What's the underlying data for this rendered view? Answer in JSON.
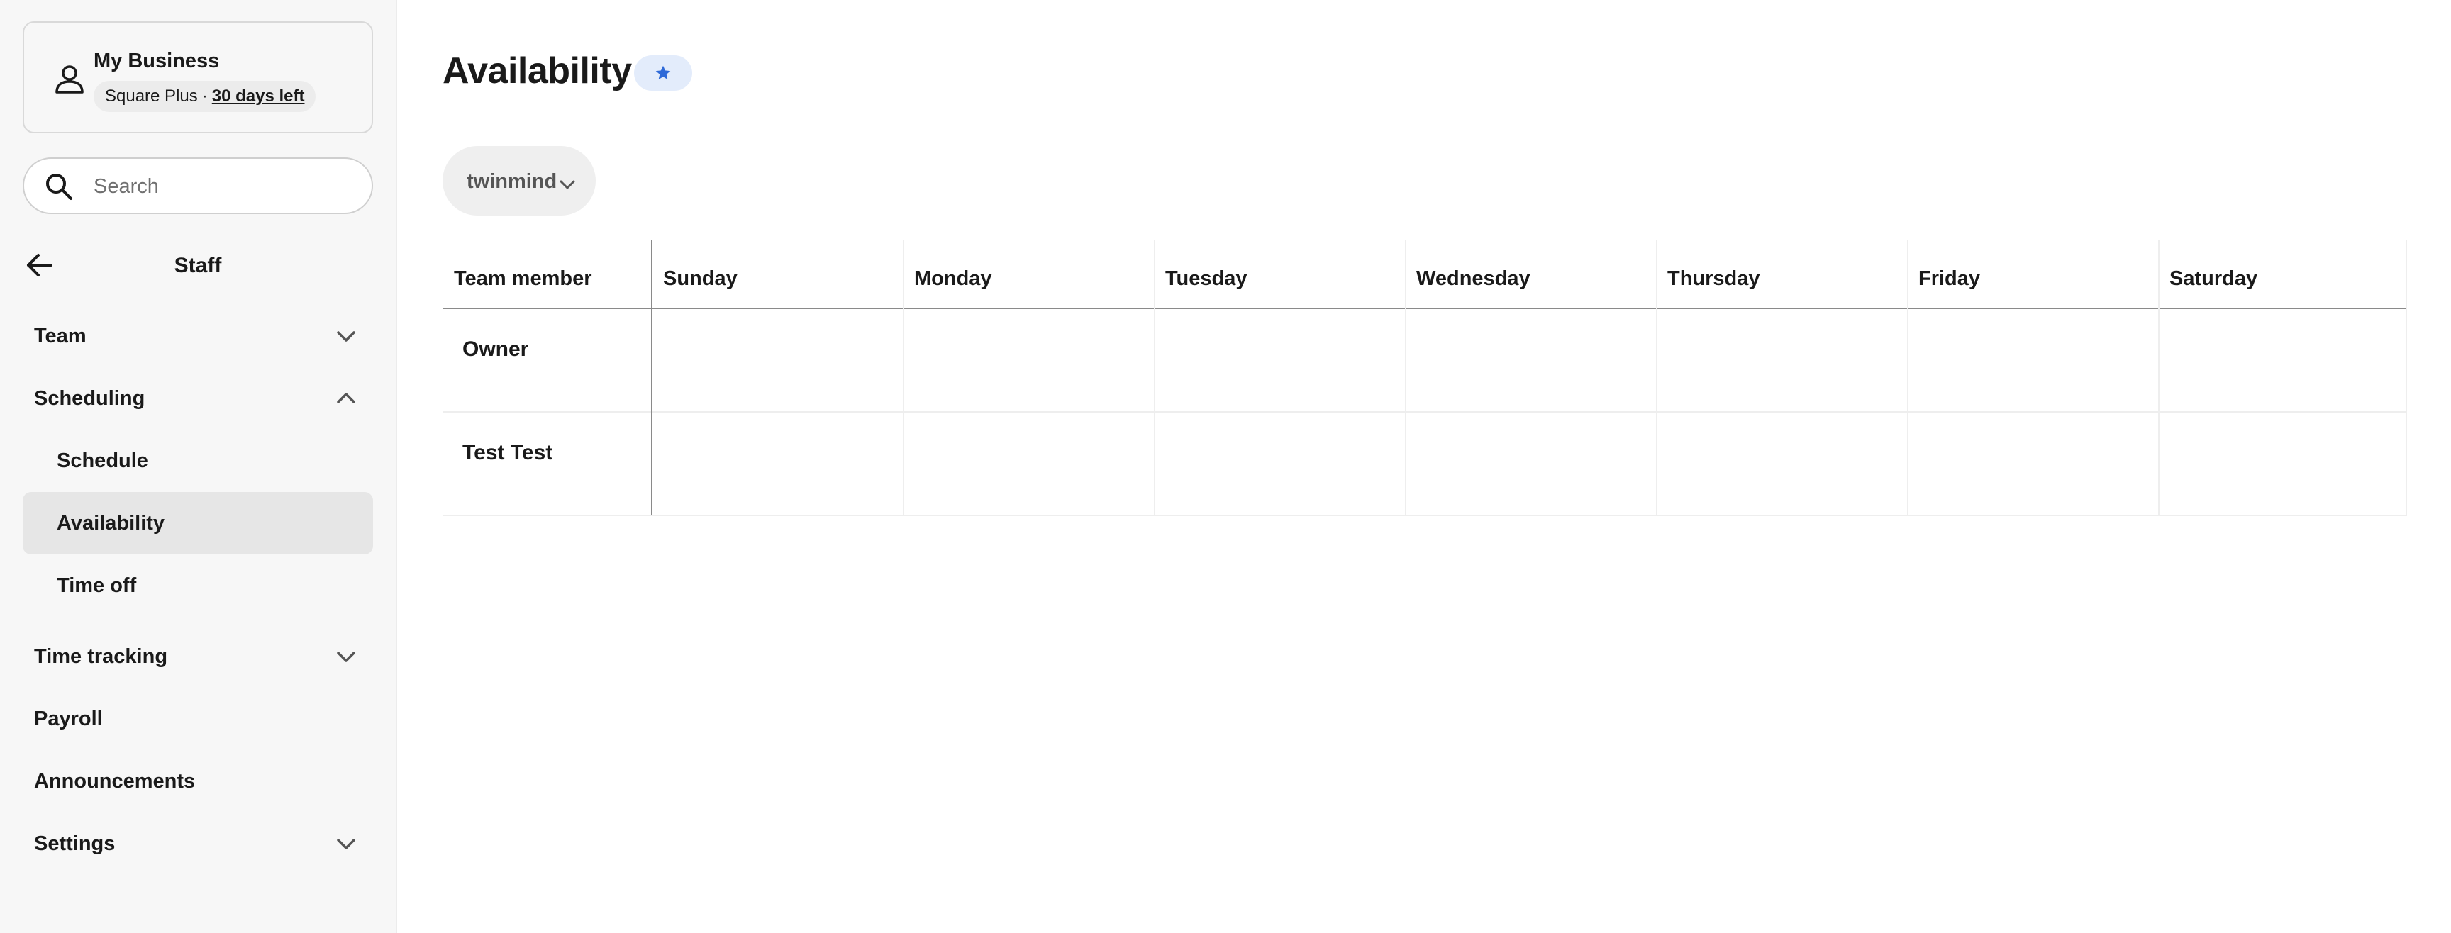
{
  "business": {
    "name": "My Business",
    "plan": "Square Plus",
    "separator": "·",
    "trial": "30 days left"
  },
  "search": {
    "placeholder": "Search"
  },
  "nav": {
    "section_title": "Staff",
    "items": [
      {
        "label": "Team",
        "expanded": false
      },
      {
        "label": "Scheduling",
        "expanded": true
      },
      {
        "label": "Schedule"
      },
      {
        "label": "Availability",
        "active": true
      },
      {
        "label": "Time off"
      },
      {
        "label": "Time tracking",
        "expanded": false
      },
      {
        "label": "Payroll"
      },
      {
        "label": "Announcements"
      },
      {
        "label": "Settings",
        "expanded": false
      }
    ]
  },
  "main": {
    "title": "Availability",
    "filter_label": "twinmind",
    "accent_color": "#2f6ad8"
  },
  "grid": {
    "columns": [
      "Team member",
      "Sunday",
      "Monday",
      "Tuesday",
      "Wednesday",
      "Thursday",
      "Friday",
      "Saturday"
    ],
    "rows": [
      "Owner",
      "Test Test"
    ]
  }
}
